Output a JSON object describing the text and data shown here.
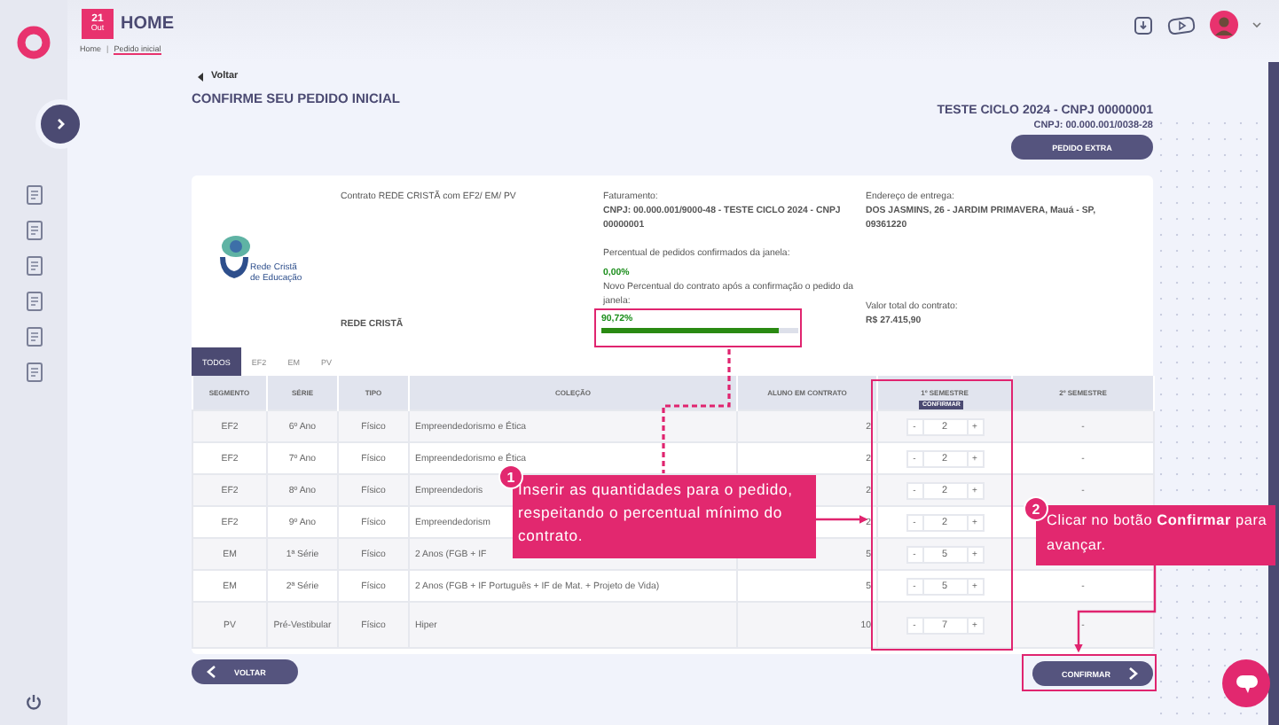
{
  "header": {
    "date_day": "21",
    "date_month": "Out",
    "title": "HOME"
  },
  "breadcrumb_separator": "|",
  "breadcrumb": [
    {
      "label": "Home",
      "selected": false
    },
    {
      "label": "Pedido inicial",
      "selected": true
    }
  ],
  "back_link": "Voltar",
  "page_title": "CONFIRME SEU PEDIDO INICIAL",
  "client": {
    "name": "TESTE CICLO 2024 - CNPJ 00000001",
    "cnpj": "CNPJ: 00.000.001/0038-28",
    "extra_button": "PEDIDO EXTRA"
  },
  "contract": {
    "title": "Contrato REDE CRISTÃ com EF2/ EM/ PV",
    "logo_text": "Rede Cristã de Educação",
    "network": "REDE CRISTÃ",
    "billing_label": "Faturamento:",
    "billing_value": "CNPJ: 00.000.001/9000-48 - TESTE CICLO 2024 - CNPJ 00000001",
    "confirmed_label": "Percentual de pedidos confirmados da janela:",
    "confirmed_value": "0,00%",
    "new_label": "Novo Percentual do contrato após a confirmação o pedido da janela:",
    "new_value": "90,72%",
    "level": 0.9,
    "address_label": "Endereço de entrega:",
    "address_value": "DOS JASMINS, 26 - JARDIM PRIMAVERA, Mauá - SP, 09361220",
    "total_label": "Valor total do contrato:",
    "total_value": "R$ 27.415,90"
  },
  "tabs": [
    {
      "label": "TODOS",
      "selected": true
    },
    {
      "label": "EF2",
      "selected": false
    },
    {
      "label": "EM",
      "selected": false
    },
    {
      "label": "PV",
      "selected": false
    }
  ],
  "table": {
    "columns": [
      "SEGMENTO",
      "SÉRIE",
      "TIPO",
      "COLEÇÃO",
      "ALUNO EM CONTRATO",
      "1º SEMESTRE",
      "2º SEMESTRE"
    ],
    "column_tag": "CONFIRMAR",
    "rows": [
      {
        "segment": "EF2",
        "grade": "6º Ano",
        "type": "Físico",
        "collection": "Empreendedorismo e Ética",
        "students": "2",
        "minus": "-",
        "qty": "2",
        "plus": "+",
        "second": "-"
      },
      {
        "segment": "EF2",
        "grade": "7º Ano",
        "type": "Físico",
        "collection": "Empreendedorismo e Ética",
        "students": "2",
        "minus": "-",
        "qty": "2",
        "plus": "+",
        "second": "-"
      },
      {
        "segment": "EF2",
        "grade": "8º Ano",
        "type": "Físico",
        "collection": "Empreendedoris",
        "students": "2",
        "minus": "-",
        "qty": "2",
        "plus": "+",
        "second": "-"
      },
      {
        "segment": "EF2",
        "grade": "9º Ano",
        "type": "Físico",
        "collection": "Empreendedorism",
        "students": "2",
        "minus": "-",
        "qty": "2",
        "plus": "+"
      },
      {
        "segment": "EM",
        "grade": "1ª Série",
        "type": "Físico",
        "collection": "2 Anos (FGB + IF",
        "students": "5",
        "minus": "-",
        "qty": "5",
        "plus": "+"
      },
      {
        "segment": "EM",
        "grade": "2ª Série",
        "type": "Físico",
        "collection": "2 Anos (FGB + IF Português + IF de Mat. + Projeto de Vida)",
        "students": "5",
        "minus": "-",
        "qty": "5",
        "plus": "+",
        "second": "-"
      },
      {
        "segment": "PV",
        "grade": "Pré-Vestibular",
        "type": "Físico",
        "collection": "Hiper",
        "students": "10",
        "minus": "-",
        "qty": "7",
        "plus": "+",
        "second": "-"
      }
    ]
  },
  "buttons": {
    "back": "VOLTAR",
    "confirm": "CONFIRMAR"
  },
  "callouts": [
    {
      "number": "1",
      "text": "Inserir as quantidades para o pedido, respeitando o percentual mínimo do contrato."
    },
    {
      "number": "2",
      "text": "Clicar no botão **Confirmar** para avançar."
    }
  ]
}
